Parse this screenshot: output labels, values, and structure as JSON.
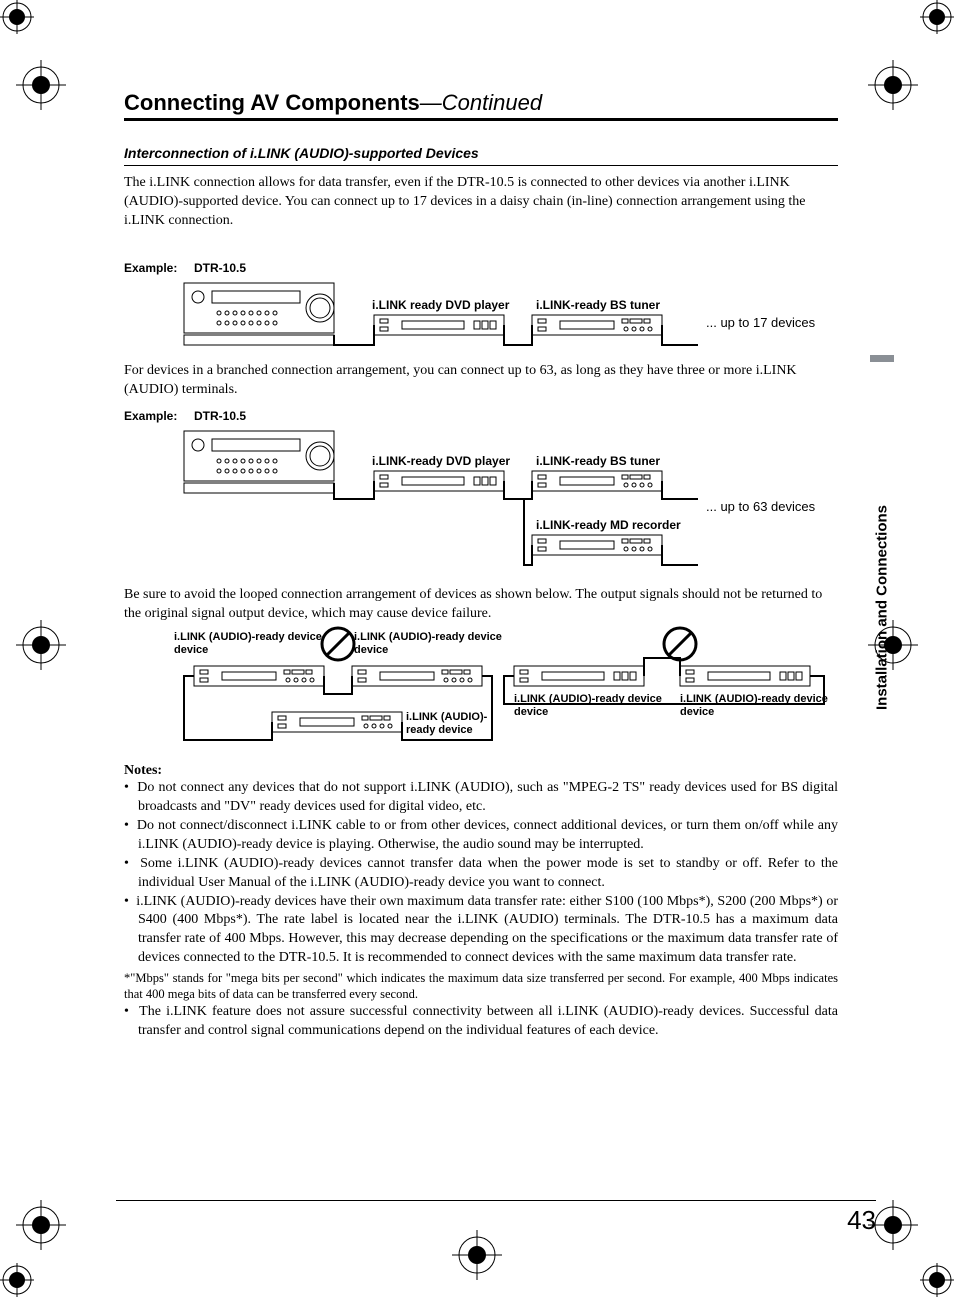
{
  "header": {
    "title_main": "Connecting AV Components",
    "title_cont": "—Continued"
  },
  "section": {
    "heading": "Interconnection of i.LINK (AUDIO)-supported Devices",
    "intro": "The i.LINK connection allows for data transfer, even if the DTR-10.5 is connected to other devices via another i.LINK (AUDIO)-supported device. You can connect up to 17 devices in a daisy chain (in-line) connection arrangement using the i.LINK connection.",
    "example_label": "Example:",
    "example1_model": "DTR-10.5",
    "diagram1": {
      "dvd": "i.LINK ready DVD player",
      "bs": "i.LINK-ready BS tuner",
      "upto": "... up to 17 devices"
    },
    "para2": "For devices in a branched connection arrangement, you can connect up to 63, as long as they have three or more i.LINK (AUDIO) terminals.",
    "example2_model": "DTR-10.5",
    "diagram2": {
      "dvd": "i.LINK-ready DVD player",
      "bs": "i.LINK-ready BS tuner",
      "md": "i.LINK-ready MD recorder",
      "upto": "... up to 63 devices"
    },
    "para3": "Be sure to avoid the looped connection arrangement of devices as shown below. The output signals should not be returned to the original signal output device, which may cause device failure.",
    "diagram3": {
      "label_a": "i.LINK (AUDIO)-ready device",
      "label_b": "i.LINK (AUDIO)-ready device",
      "label_c": "i.LINK (AUDIO)-ready device",
      "label_d": "i.LINK (AUDIO)-ready device",
      "label_e": "i.LINK (AUDIO)-ready device"
    }
  },
  "notes": {
    "heading": "Notes:",
    "items": [
      "Do not connect any devices that do not support i.LINK (AUDIO), such as \"MPEG-2 TS\" ready devices used for BS digital broadcasts and \"DV\" ready devices used for digital video, etc.",
      "Do not connect/disconnect i.LINK cable to or from other devices, connect additional devices, or turn them on/off while any i.LINK (AUDIO)-ready device is playing. Otherwise, the audio sound may be interrupted.",
      "Some i.LINK (AUDIO)-ready devices cannot transfer data when the power mode is set to standby or off. Refer to the individual User Manual of the i.LINK (AUDIO)-ready device you want to connect.",
      "i.LINK (AUDIO)-ready devices have their own maximum data transfer rate: either S100 (100 Mbps*), S200 (200 Mbps*) or S400 (400 Mbps*). The rate label is located near the i.LINK (AUDIO) terminals. The DTR-10.5 has a maximum data transfer rate of 400 Mbps. However, this may decrease depending on the specifications or the maximum data transfer rate of devices connected to the DTR-10.5. It is recommended to connect devices with the same maximum data transfer rate."
    ],
    "footnote": "*\"Mbps\" stands for \"mega bits per second\" which indicates the maximum data size transferred per second. For example, 400 Mbps indicates that 400 mega bits of data can be transferred every second.",
    "item_last": "The i.LINK feature does not assure successful connectivity between all i.LINK (AUDIO)-ready devices. Successful data transfer and control signal communications depend on the individual features of each device."
  },
  "side_tab": "Installation and Connections",
  "page_number": "43"
}
